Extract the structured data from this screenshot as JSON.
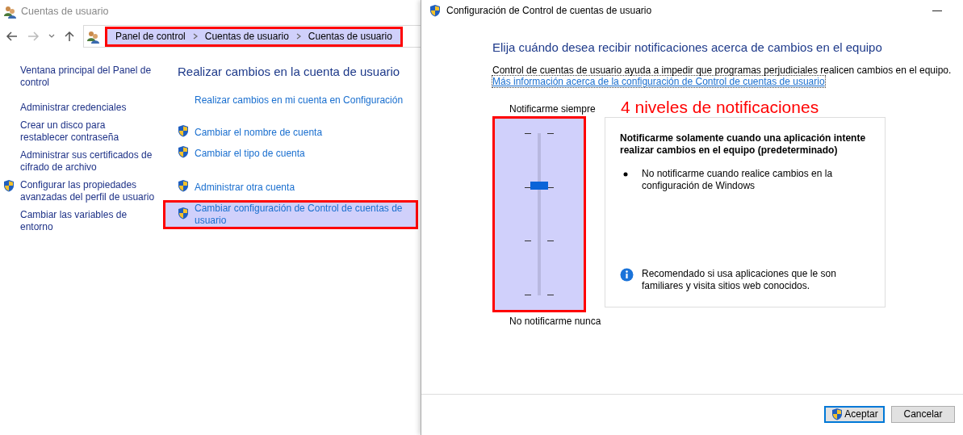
{
  "main_window": {
    "title": "Cuentas de usuario",
    "breadcrumb": {
      "highlighted": true,
      "items": [
        "Panel de control",
        "Cuentas de usuario",
        "Cuentas de usuario"
      ]
    },
    "sidebar_groups": [
      [
        {
          "label": "Ventana principal del Panel de control",
          "shield": false
        }
      ],
      [
        {
          "label": "Administrar credenciales",
          "shield": false
        },
        {
          "label": "Crear un disco para restablecer contraseña",
          "shield": false
        },
        {
          "label": "Administrar sus certificados de cifrado de archivo",
          "shield": false
        },
        {
          "label": "Configurar las propiedades avanzadas del perfil de usuario",
          "shield": true
        },
        {
          "label": "Cambiar las variables de entorno",
          "shield": false
        }
      ]
    ],
    "heading": "Realizar cambios en la cuenta de usuario",
    "task_groups": [
      [
        {
          "label": "Realizar cambios en mi cuenta en Configuración",
          "shield": false,
          "highlighted": false
        }
      ],
      [
        {
          "label": "Cambiar el nombre de cuenta",
          "shield": true,
          "highlighted": false
        },
        {
          "label": "Cambiar el tipo de cuenta",
          "shield": true,
          "highlighted": false
        }
      ],
      [
        {
          "label": "Administrar otra cuenta",
          "shield": true,
          "highlighted": false
        },
        {
          "label": "Cambiar configuración de Control de cuentas de usuario",
          "shield": true,
          "highlighted": true
        }
      ]
    ]
  },
  "uac_dialog": {
    "title": "Configuración de Control de cuentas de usuario",
    "minimize": "—",
    "heading": "Elija cuándo desea recibir notificaciones acerca de cambios en el equipo",
    "description": "Control de cuentas de usuario ayuda a impedir que programas perjudiciales realicen cambios en el equipo.",
    "link": "Más información acerca de la configuración de Control de cuentas de usuario",
    "slider": {
      "top_label": "Notificarme siempre",
      "bottom_label": "No notificarme nunca",
      "level": 0.667,
      "highlighted": true
    },
    "annotation": "4 niveles de notificaciones",
    "info": {
      "title": "Notificarme solamente cuando una aplicación intente realizar cambios en el equipo (predeterminado)",
      "bullets": [
        "No notificarme cuando realice cambios en la configuración de Windows"
      ],
      "note": "Recomendado si usa aplicaciones que le son familiares y visita sitios web conocidos."
    },
    "buttons": [
      {
        "label": "Aceptar",
        "shield": true,
        "default": true
      },
      {
        "label": "Cancelar",
        "shield": false,
        "default": false
      }
    ]
  }
}
